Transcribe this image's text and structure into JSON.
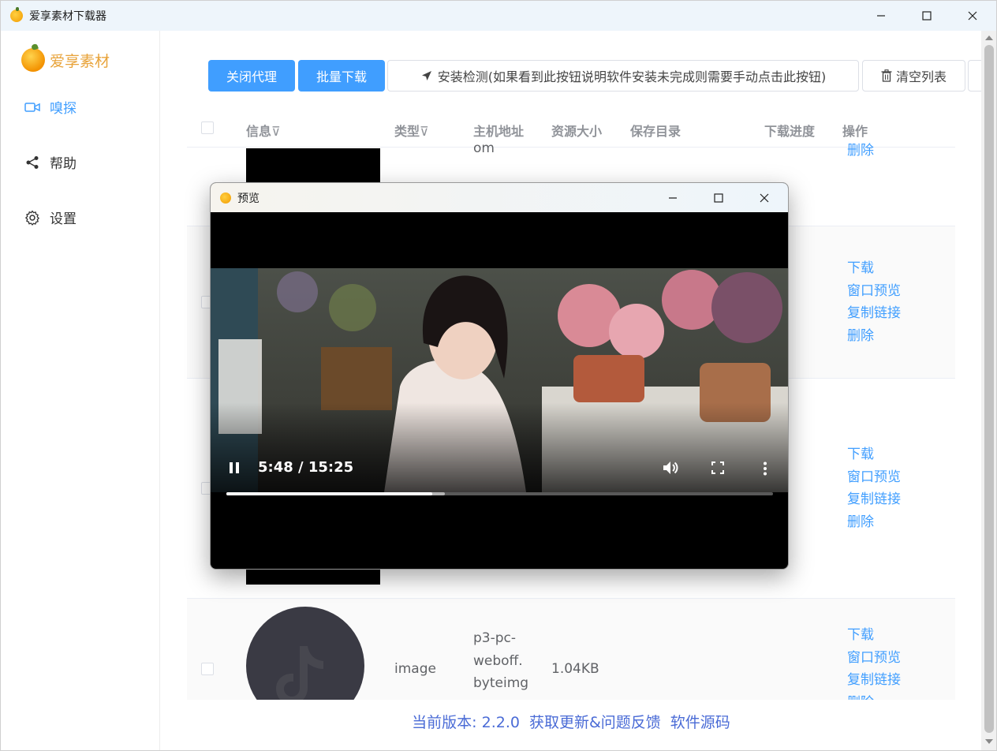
{
  "window": {
    "title": "爱享素材下载器"
  },
  "sidebar": {
    "brand": "爱享素材",
    "items": [
      {
        "label": "嗅探",
        "icon": "video-camera-icon",
        "active": true
      },
      {
        "label": "帮助",
        "icon": "share-icon",
        "active": false
      },
      {
        "label": "设置",
        "icon": "gear-icon",
        "active": false
      }
    ]
  },
  "toolbar": {
    "close_proxy": "关闭代理",
    "batch_download": "批量下载",
    "install_check": "安装检测(如果看到此按钮说明软件安装未完成则需要手动点击此按钮)",
    "clear_list": "清空列表"
  },
  "table": {
    "headers": {
      "info": "信息",
      "type": "类型",
      "host": "主机地址",
      "size": "资源大小",
      "save_dir": "保存目录",
      "progress": "下载进度",
      "actions": "操作"
    },
    "rows": [
      {
        "host_tail": "om",
        "actions": [
          "删除"
        ]
      },
      {
        "actions": [
          "下载",
          "窗口预览",
          "复制链接",
          "删除"
        ]
      },
      {
        "actions": [
          "下载",
          "窗口预览",
          "复制链接",
          "删除"
        ]
      },
      {
        "type": "image",
        "host": [
          "p3-pc-",
          "weboff.",
          "byteimg"
        ],
        "size": "1.04KB",
        "actions": [
          "下载",
          "窗口预览",
          "复制链接",
          "删除"
        ]
      }
    ]
  },
  "footer": {
    "version": "当前版本: 2.2.0",
    "update": "获取更新&问题反馈",
    "source": "软件源码"
  },
  "preview": {
    "title": "预览",
    "time": "5:48 / 15:25",
    "progress_fraction": 0.376
  },
  "colors": {
    "primary": "#409eff",
    "brand": "#e8a33a",
    "footer_link": "#4a6bd6"
  }
}
